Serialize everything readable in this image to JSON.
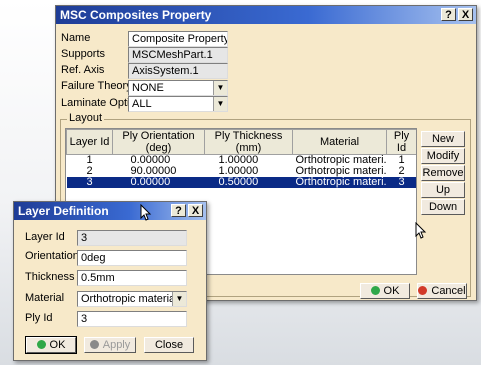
{
  "main_dialog": {
    "title": "MSC Composites Property",
    "help_label": "?",
    "close_label": "X",
    "fields": {
      "name": {
        "label": "Name",
        "value": "Composite Property"
      },
      "supports": {
        "label": "Supports",
        "value": "MSCMeshPart.1"
      },
      "ref_axis": {
        "label": "Ref. Axis",
        "value": "AxisSystem.1"
      },
      "failure_theory": {
        "label": "Failure Theory",
        "value": "NONE"
      },
      "laminate_option": {
        "label": "Laminate Option",
        "value": "ALL"
      }
    },
    "layout_group": "Layout",
    "table": {
      "headers": [
        "Layer Id",
        "Ply Orientation (deg)",
        "Ply Thickness (mm)",
        "Material",
        "Ply Id"
      ],
      "rows": [
        [
          "1",
          "0.00000",
          "1.00000",
          "Orthotropic materi...",
          "1"
        ],
        [
          "2",
          "90.00000",
          "1.00000",
          "Orthotropic materi...",
          "2"
        ],
        [
          "3",
          "0.00000",
          "0.50000",
          "Orthotropic materi...",
          "3"
        ]
      ]
    },
    "side_buttons": {
      "new": "New",
      "modify": "Modify",
      "remove": "Remove",
      "up": "Up",
      "down": "Down"
    },
    "ok_label": "OK",
    "cancel_label": "Cancel"
  },
  "layer_dialog": {
    "title": "Layer Definition",
    "help_label": "?",
    "close_label": "X",
    "layer_id": {
      "label": "Layer Id",
      "value": "3"
    },
    "orientation": {
      "label": "Orientation",
      "value": "0deg"
    },
    "thickness": {
      "label": "Thickness",
      "value": "0.5mm"
    },
    "material": {
      "label": "Material",
      "value": "Orthotropic material."
    },
    "ply_id": {
      "label": "Ply Id",
      "value": "3"
    },
    "ok_label": "OK",
    "apply_label": "Apply",
    "close_button_label": "Close"
  },
  "colors": {
    "dialog_bg": "#f7e9c9",
    "title_blue": "#1e3c96",
    "selection": "#0a2a86",
    "ok_green": "#2fa84a",
    "cancel_red": "#d23a2a"
  },
  "icons": {
    "combo": "chevron-down-icon",
    "cursor": "mouse-pointer-icon"
  }
}
